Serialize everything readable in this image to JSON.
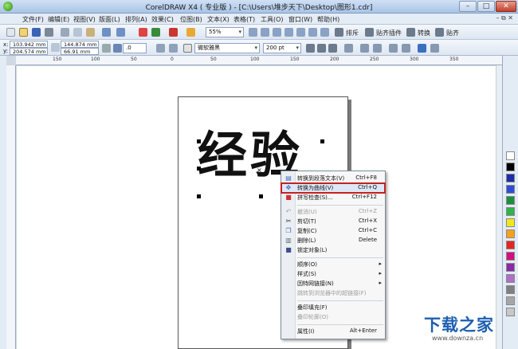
{
  "window": {
    "title": "CorelDRAW X4 ( 专业版 ) - [C:\\Users\\堆步天下\\Desktop\\图形1.cdr]"
  },
  "menu": [
    "文件(F)",
    "编辑(E)",
    "视图(V)",
    "版面(L)",
    "排列(A)",
    "效果(C)",
    "位图(B)",
    "文本(X)",
    "表格(T)",
    "工具(O)",
    "窗口(W)",
    "帮助(H)"
  ],
  "toolbar": {
    "zoom": "55%",
    "labels": {
      "arrange": "排斥",
      "snap": "贴齐插件",
      "convert": "转换",
      "align": "贴齐"
    }
  },
  "propbar": {
    "x": "103.942 mm",
    "y": "204.574 mm",
    "w": "144.874 mm",
    "h": "66.91 mm",
    "rotation": ".0",
    "font": "微软雅黑",
    "font_size": "200 pt"
  },
  "ruler": {
    "ticks": [
      "150",
      "100",
      "50",
      "0",
      "50",
      "100",
      "150",
      "200",
      "250",
      "300",
      "350"
    ]
  },
  "canvas_text": "经验",
  "context_menu": [
    {
      "label": "转换到段落文本(V)",
      "shortcut": "Ctrl+F8",
      "disabled": false
    },
    {
      "label": "转换为曲线(V)",
      "shortcut": "Ctrl+Q",
      "disabled": false,
      "highlighted": true
    },
    {
      "label": "拼写检查(S)...",
      "shortcut": "Ctrl+F12",
      "disabled": false
    },
    {
      "label": "撤消(U)",
      "shortcut": "Ctrl+Z",
      "disabled": true
    },
    {
      "label": "剪切(T)",
      "shortcut": "Ctrl+X",
      "disabled": false
    },
    {
      "label": "复制(C)",
      "shortcut": "Ctrl+C",
      "disabled": false
    },
    {
      "label": "删除(L)",
      "shortcut": "Delete",
      "disabled": false
    },
    {
      "label": "锁定对象(L)",
      "shortcut": "",
      "disabled": false
    },
    {
      "label": "顺序(O)",
      "shortcut": "",
      "disabled": false,
      "submenu": true
    },
    {
      "label": "样式(S)",
      "shortcut": "",
      "disabled": false,
      "submenu": true
    },
    {
      "label": "因特网链接(N)",
      "shortcut": "",
      "disabled": false,
      "submenu": true
    },
    {
      "label": "跳转到浏览器中的超链接(F)",
      "shortcut": "",
      "disabled": true
    },
    {
      "label": "叠印填充(F)",
      "shortcut": "",
      "disabled": false
    },
    {
      "label": "叠印轮廓(O)",
      "shortcut": "",
      "disabled": true
    },
    {
      "label": "属性(I)",
      "shortcut": "Alt+Enter",
      "disabled": false
    }
  ],
  "palette_colors": [
    "#ffffff",
    "#000000",
    "#1d2ea8",
    "#2f4bd6",
    "#1b8f3c",
    "#2fb34a",
    "#f0e81c",
    "#f7a11a",
    "#e3261f",
    "#d5107a",
    "#8a2aa4",
    "#b06ec4",
    "#7f7f7f",
    "#a6a6a6",
    "#c8c8c8"
  ],
  "watermark": {
    "brand": "下载之家",
    "url": "www.downza.cn"
  }
}
